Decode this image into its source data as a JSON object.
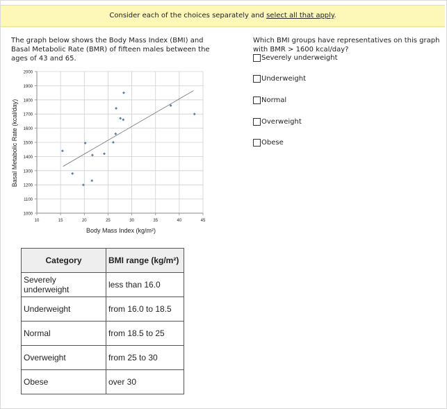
{
  "banner": {
    "text_before": "Consider each of the choices separately and ",
    "link_text": "select all that apply",
    "text_after": "."
  },
  "question": {
    "text": "The graph below shows the Body Mass Index (BMI) and Basal Metabolic Rate (BMR) of fifteen males between the ages of 43 and 65."
  },
  "prompt": "Which BMI groups have representatives on this graph with BMR > 1600 kcal/day?",
  "options": [
    {
      "label": "Severely underweight",
      "checked": false
    },
    {
      "label": "Underweight",
      "checked": false
    },
    {
      "label": "Normal",
      "checked": false
    },
    {
      "label": "Overweight",
      "checked": false
    },
    {
      "label": "Obese",
      "checked": false
    }
  ],
  "table": {
    "headers": [
      "Category",
      "BMI range (kg/m²)"
    ],
    "rows": [
      [
        "Severely underweight",
        "less than 16.0"
      ],
      [
        "Underweight",
        "from 16.0 to 18.5"
      ],
      [
        "Normal",
        "from 18.5 to 25"
      ],
      [
        "Overweight",
        "from 25 to 30"
      ],
      [
        "Obese",
        "over 30"
      ]
    ]
  },
  "chart_data": {
    "type": "scatter",
    "title": "",
    "xlabel": "Body Mass Index (kg/m²)",
    "ylabel": "Basal Metabolic Rate (kcal/day)",
    "xlim": [
      10,
      45
    ],
    "ylim": [
      1000,
      2000
    ],
    "xticks": [
      10,
      15,
      20,
      25,
      30,
      35,
      40,
      45
    ],
    "yticks": [
      1000,
      1100,
      1200,
      1300,
      1400,
      1500,
      1600,
      1700,
      1800,
      1900,
      2000
    ],
    "grid": true,
    "points": [
      {
        "x": 15.4,
        "y": 1440
      },
      {
        "x": 17.5,
        "y": 1280
      },
      {
        "x": 19.8,
        "y": 1200
      },
      {
        "x": 20.2,
        "y": 1495
      },
      {
        "x": 21.6,
        "y": 1230
      },
      {
        "x": 21.7,
        "y": 1410
      },
      {
        "x": 24.2,
        "y": 1420
      },
      {
        "x": 26.1,
        "y": 1500
      },
      {
        "x": 26.6,
        "y": 1560
      },
      {
        "x": 26.7,
        "y": 1740
      },
      {
        "x": 27.6,
        "y": 1670
      },
      {
        "x": 28.2,
        "y": 1660
      },
      {
        "x": 28.3,
        "y": 1850
      },
      {
        "x": 38.2,
        "y": 1760
      },
      {
        "x": 43.2,
        "y": 1700
      }
    ],
    "trendline": {
      "x": [
        15.5,
        43.0
      ],
      "y": [
        1330,
        1865
      ]
    },
    "marker_color": "#5a7fb5",
    "line_color": "#7f7f7f"
  }
}
